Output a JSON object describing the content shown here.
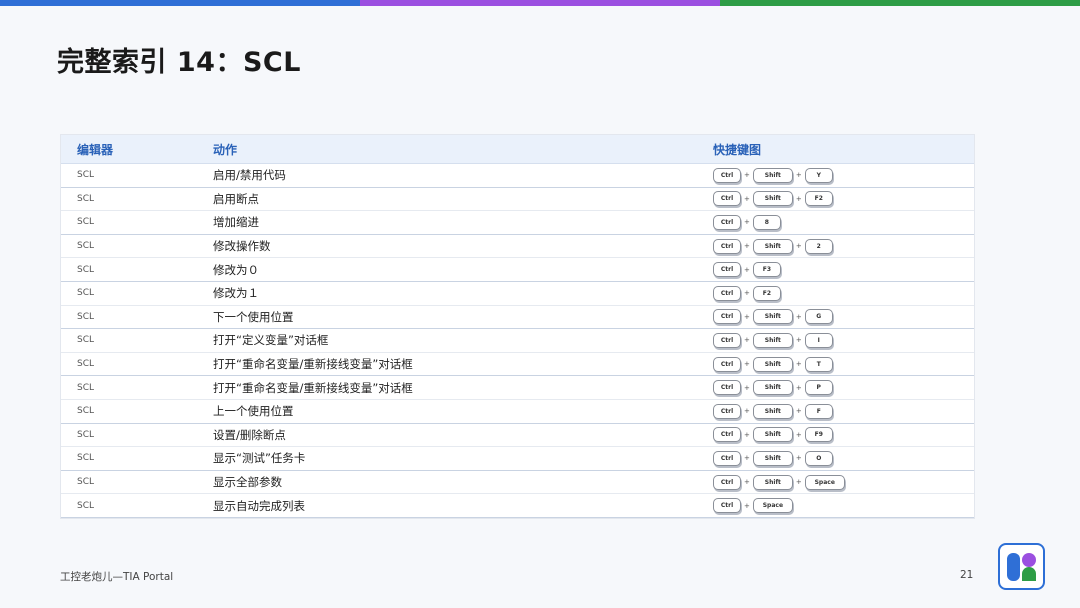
{
  "colors": {
    "bar_blue": "#2f6fd6",
    "bar_purple": "#9b4fe0",
    "bar_green": "#2e9d46",
    "header_text": "#2a62b8"
  },
  "title": "完整索引 14：SCL",
  "table": {
    "headers": {
      "editor": "编辑器",
      "action": "动作",
      "shortcut": "快捷键图"
    },
    "rows": [
      {
        "editor": "SCL",
        "action": "启用/禁用代码",
        "keys": [
          "Ctrl",
          "Shift",
          "Y"
        ]
      },
      {
        "editor": "SCL",
        "action": "启用断点",
        "keys": [
          "Ctrl",
          "Shift",
          "F2"
        ]
      },
      {
        "editor": "SCL",
        "action": "增加缩进",
        "keys": [
          "Ctrl",
          "8"
        ]
      },
      {
        "editor": "SCL",
        "action": "修改操作数",
        "keys": [
          "Ctrl",
          "Shift",
          "2"
        ]
      },
      {
        "editor": "SCL",
        "action": "修改为０",
        "keys": [
          "Ctrl",
          "F3"
        ]
      },
      {
        "editor": "SCL",
        "action": "修改为１",
        "keys": [
          "Ctrl",
          "F2"
        ]
      },
      {
        "editor": "SCL",
        "action": "下一个使用位置",
        "keys": [
          "Ctrl",
          "Shift",
          "G"
        ]
      },
      {
        "editor": "SCL",
        "action": "打开“定义变量”对话框",
        "keys": [
          "Ctrl",
          "Shift",
          "I"
        ]
      },
      {
        "editor": "SCL",
        "action": "打开“重命名变量/重新接线变量”对话框",
        "keys": [
          "Ctrl",
          "Shift",
          "T"
        ]
      },
      {
        "editor": "SCL",
        "action": "打开“重命名变量/重新接线变量”对话框",
        "keys": [
          "Ctrl",
          "Shift",
          "P"
        ]
      },
      {
        "editor": "SCL",
        "action": "上一个使用位置",
        "keys": [
          "Ctrl",
          "Shift",
          "F"
        ]
      },
      {
        "editor": "SCL",
        "action": "设置/删除断点",
        "keys": [
          "Ctrl",
          "Shift",
          "F9"
        ]
      },
      {
        "editor": "SCL",
        "action": "显示“测试”任务卡",
        "keys": [
          "Ctrl",
          "Shift",
          "O"
        ]
      },
      {
        "editor": "SCL",
        "action": "显示全部参数",
        "keys": [
          "Ctrl",
          "Shift",
          "Space"
        ]
      },
      {
        "editor": "SCL",
        "action": "显示自动完成列表",
        "keys": [
          "Ctrl",
          "Space"
        ]
      }
    ]
  },
  "footer": {
    "text": "工控老炮儿—TIA Portal",
    "page": "21"
  },
  "logo_icon": "brand-logo-icon"
}
